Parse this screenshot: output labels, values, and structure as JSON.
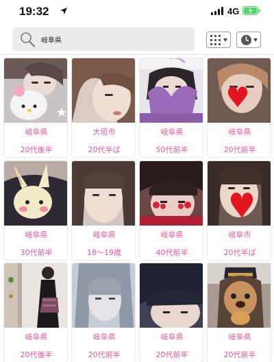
{
  "status_bar": {
    "time": "19:32",
    "network": "4G"
  },
  "search": {
    "query": "岐阜県"
  },
  "toolbar": {
    "grid_icon": "grid-view-icon",
    "history_icon": "clock-icon"
  },
  "colors": {
    "accent": "#e8579a",
    "search_bg": "#ebebeb",
    "battery": "#4cd964"
  },
  "profiles": [
    {
      "area": "岐阜県",
      "age": "20代後半"
    },
    {
      "area": "大垣市",
      "age": "20代半ば"
    },
    {
      "area": "岐阜県",
      "age": "50代前半"
    },
    {
      "area": "岐阜県",
      "age": "20代前半"
    },
    {
      "area": "岐阜県",
      "age": "30代前半"
    },
    {
      "area": "岐阜県",
      "age": "18〜19歳"
    },
    {
      "area": "岐阜県",
      "age": "40代前半"
    },
    {
      "area": "岐阜市",
      "age": "20代半ば"
    },
    {
      "area": "岐阜県",
      "age": "20代後半"
    },
    {
      "area": "岐阜県",
      "age": "20代前半"
    },
    {
      "area": "岐阜県",
      "age": "20代前半"
    },
    {
      "area": "岐阜県",
      "age": "20代前半"
    }
  ]
}
